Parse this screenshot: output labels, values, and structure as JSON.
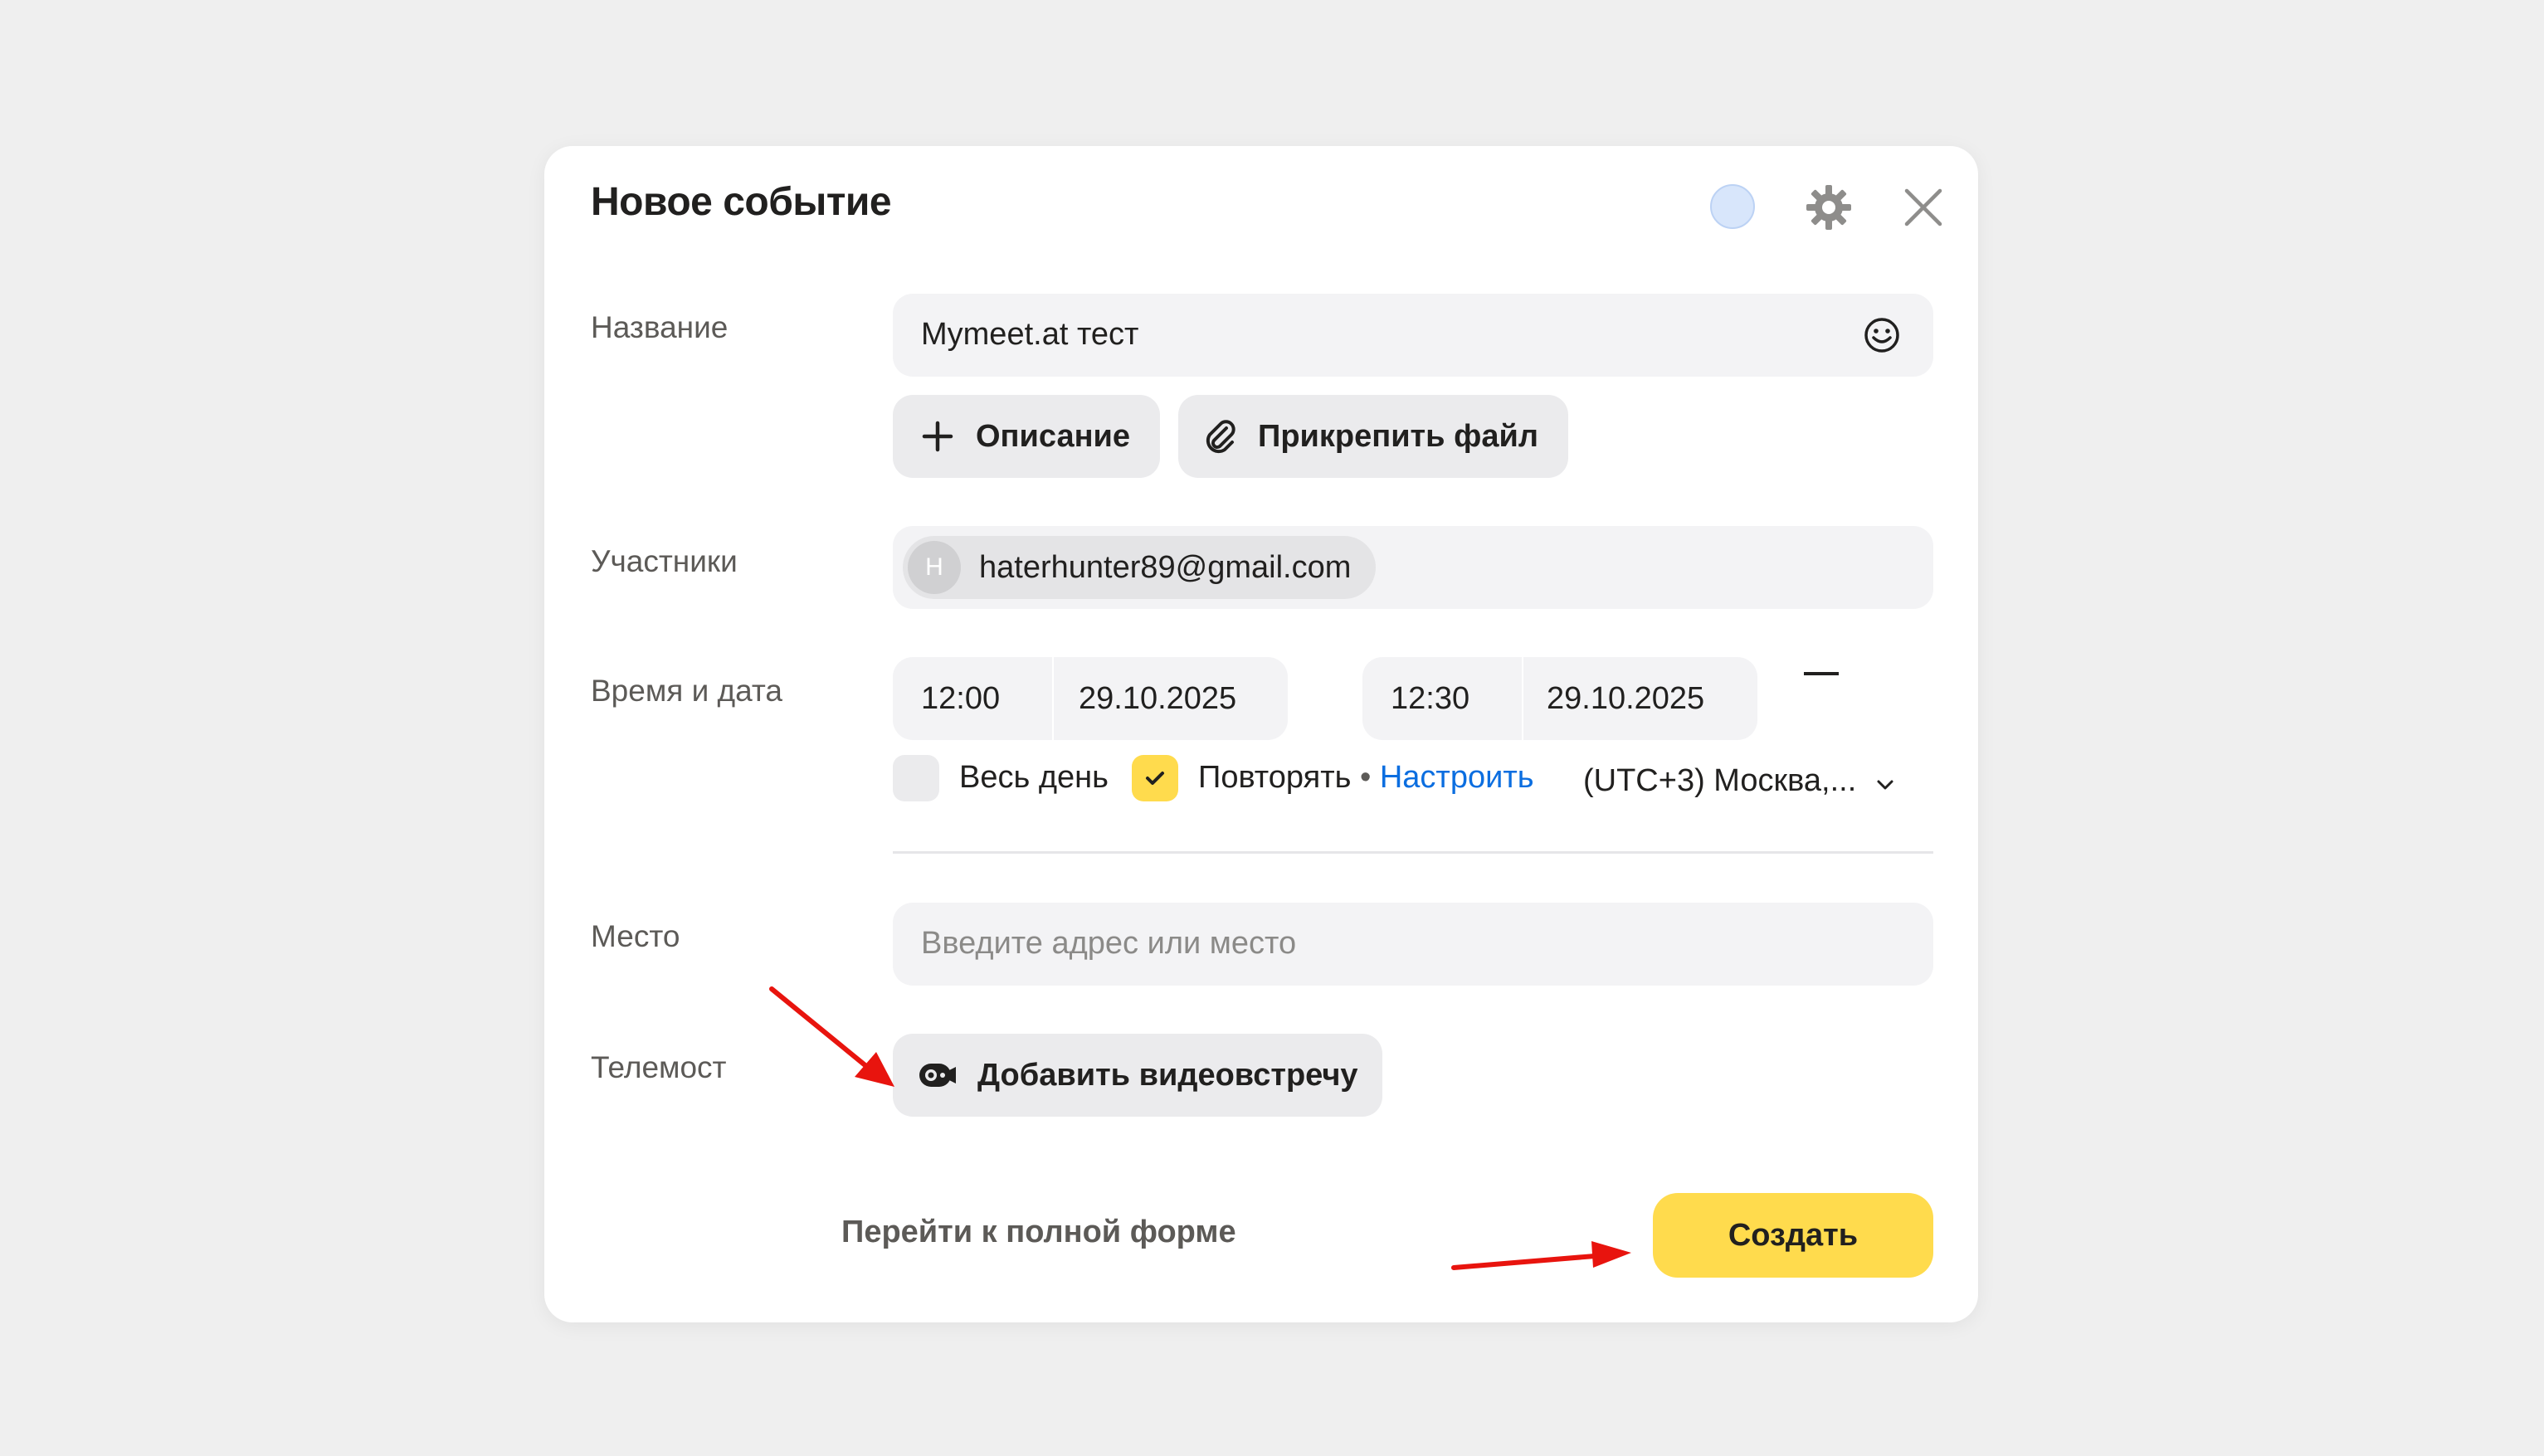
{
  "dialog": {
    "title": "Новое событие"
  },
  "form": {
    "name": {
      "label": "Название",
      "value": "Mymeet.at тест"
    },
    "description_button": "Описание",
    "attach_button": "Прикрепить файл",
    "participants": {
      "label": "Участники",
      "chip_initial": "H",
      "chip_email": "haterhunter89@gmail.com"
    },
    "datetime": {
      "label": "Время и дата",
      "start_time": "12:00",
      "start_date": "29.10.2025",
      "end_time": "12:30",
      "end_date": "29.10.2025",
      "all_day_label": "Весь день",
      "all_day_checked": false,
      "repeat_label": "Повторять",
      "repeat_checked": true,
      "separator": "•",
      "configure_link": "Настроить",
      "timezone": "(UTC+3) Москва,..."
    },
    "place": {
      "label": "Место",
      "placeholder": "Введите адрес или место"
    },
    "telemost": {
      "label": "Телемост",
      "button": "Добавить видеовстречу"
    }
  },
  "footer": {
    "full_form_link": "Перейти к полной форме",
    "create_button": "Создать"
  },
  "colors": {
    "accent_yellow": "#ffdb4d",
    "link_blue": "#0b6ee0",
    "annotation_red": "#e8140e",
    "field_bg": "#f3f3f5"
  },
  "icons": [
    "color-circle-icon",
    "gear-icon",
    "close-icon",
    "emoji-icon",
    "plus-icon",
    "paperclip-icon",
    "check-icon",
    "chevron-down-icon",
    "telemost-camera-icon"
  ]
}
